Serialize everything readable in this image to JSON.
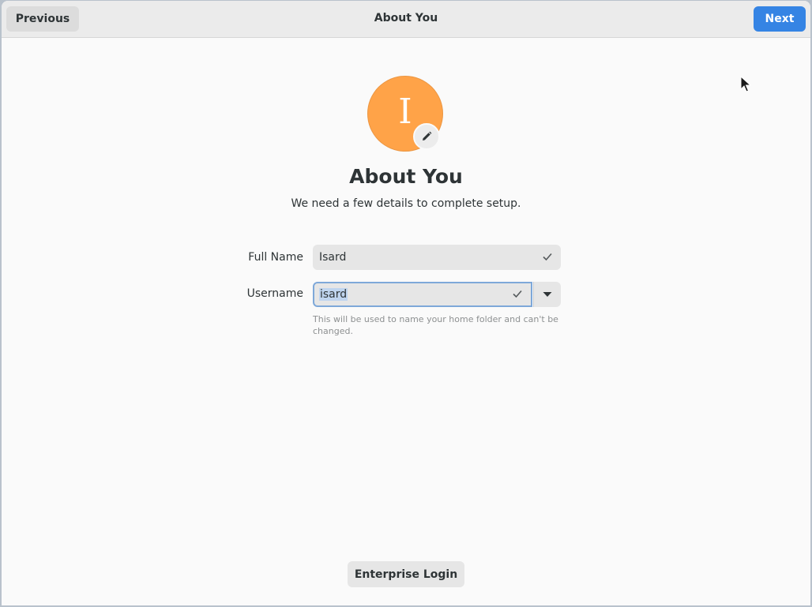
{
  "header": {
    "title": "About You",
    "previous_label": "Previous",
    "next_label": "Next"
  },
  "avatar": {
    "initial": "I",
    "color": "#ffa348",
    "edit_icon": "pencil-icon"
  },
  "page": {
    "heading": "About You",
    "subtitle": "We need a few details to complete setup."
  },
  "form": {
    "full_name": {
      "label": "Full Name",
      "value": "Isard",
      "status_icon": "checkmark-icon"
    },
    "username": {
      "label": "Username",
      "value": "isard",
      "status_icon": "checkmark-icon",
      "hint": "This will be used to name your home folder and can't be changed."
    }
  },
  "footer": {
    "enterprise_login_label": "Enterprise Login"
  },
  "colors": {
    "accent": "#3584e4",
    "focus_ring": "#7ea8d9",
    "selection": "#c0d5ef"
  }
}
